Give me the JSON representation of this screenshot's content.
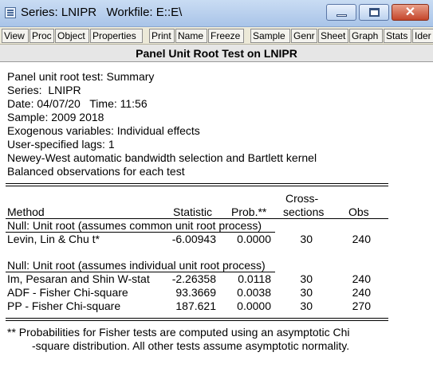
{
  "window": {
    "title": "Series: LNIPR   Workfile: E::E\\"
  },
  "toolbar": {
    "buttons": [
      "View",
      "Proc",
      "Object",
      "Properties",
      "Print",
      "Name",
      "Freeze",
      "Sample",
      "Genr",
      "Sheet",
      "Graph",
      "Stats",
      "Ider"
    ]
  },
  "header": {
    "title": "Panel Unit Root Test on LNIPR"
  },
  "summary": {
    "lines": [
      "Panel unit root test: Summary",
      "Series:  LNIPR",
      "Date: 04/07/20   Time: 11:56",
      "Sample: 2009 2018",
      "Exogenous variables: Individual effects",
      "User-specified lags: 1",
      "Newey-West automatic bandwidth selection and Bartlett kernel",
      "Balanced observations for each test"
    ]
  },
  "table": {
    "columns": {
      "method": "Method",
      "statistic": "Statistic",
      "prob": "Prob.**",
      "cross_line1": "Cross-",
      "cross_line2": "sections",
      "obs": "Obs"
    },
    "sections": [
      {
        "heading": "Null: Unit root (assumes common unit root process)",
        "rows": [
          {
            "method": "Levin, Lin & Chu t*",
            "statistic": "-6.00943",
            "prob": "0.0000",
            "cross": "30",
            "obs": "240"
          }
        ]
      },
      {
        "heading": "Null: Unit root (assumes individual unit root process)",
        "rows": [
          {
            "method": "Im, Pesaran and Shin W-stat",
            "statistic": "-2.26358",
            "prob": "0.0118",
            "cross": "30",
            "obs": "240"
          },
          {
            "method": "ADF - Fisher Chi-square",
            "statistic": "93.3669",
            "prob": "0.0038",
            "cross": "30",
            "obs": "240"
          },
          {
            "method": "PP - Fisher Chi-square",
            "statistic": "187.621",
            "prob": "0.0000",
            "cross": "30",
            "obs": "270"
          }
        ]
      }
    ]
  },
  "footnote": {
    "line1": "** Probabilities for Fisher tests are computed using an asymptotic Chi",
    "line2": "-square distribution. All other tests assume asymptotic normality."
  }
}
